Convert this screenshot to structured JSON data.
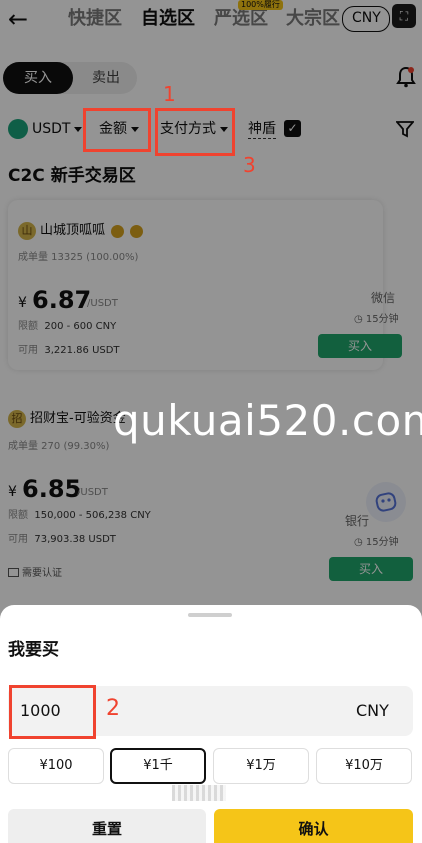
{
  "header": {
    "tabs": [
      {
        "label": "快捷区"
      },
      {
        "label": "自选区"
      },
      {
        "label": "严选区",
        "badge": "100%履行"
      },
      {
        "label": "大宗区"
      }
    ],
    "active_tab": "自选区",
    "currency": "CNY"
  },
  "trade_toggle": {
    "buy": "买入",
    "sell": "卖出"
  },
  "filters": {
    "coin": "USDT",
    "amount": "金额",
    "payment": "支付方式",
    "shield": "神盾"
  },
  "annotations": {
    "n1": "1",
    "n2": "2",
    "n3": "3"
  },
  "section_title": "C2C 新手交易区",
  "merchants": [
    {
      "avatar": "山",
      "name": "山城顶呱呱",
      "stats": "成单量 13325 (100.00%)",
      "currency_symbol": "¥",
      "price": "6.87",
      "unit": "/USDT",
      "limit_label": "限额",
      "limit": "200 - 600 CNY",
      "available_label": "可用",
      "available": "3,221.86 USDT",
      "payment": "微信",
      "time": "15分钟",
      "action": "买入"
    },
    {
      "avatar": "招",
      "name": "招财宝-可验资金",
      "stats": "成单量 270 (99.30%)",
      "currency_symbol": "¥",
      "price": "6.85",
      "unit": "/USDT",
      "limit_label": "限额",
      "limit": "150,000 - 506,238 CNY",
      "available_label": "可用",
      "available": "73,903.38 USDT",
      "payment": "银行",
      "time": "15分钟",
      "action": "买入",
      "tag": "需要认证"
    }
  ],
  "watermark": "qukuai520.com",
  "sheet": {
    "title": "我要买",
    "amount_value": "1000",
    "amount_currency": "CNY",
    "presets": [
      "¥100",
      "¥1千",
      "¥1万",
      "¥10万"
    ],
    "selected_preset": "¥1千",
    "reset": "重置",
    "confirm": "确认"
  },
  "colors": {
    "accent": "#f5c518",
    "buy_green": "#1fa66b",
    "annotation_red": "#f0432f"
  }
}
